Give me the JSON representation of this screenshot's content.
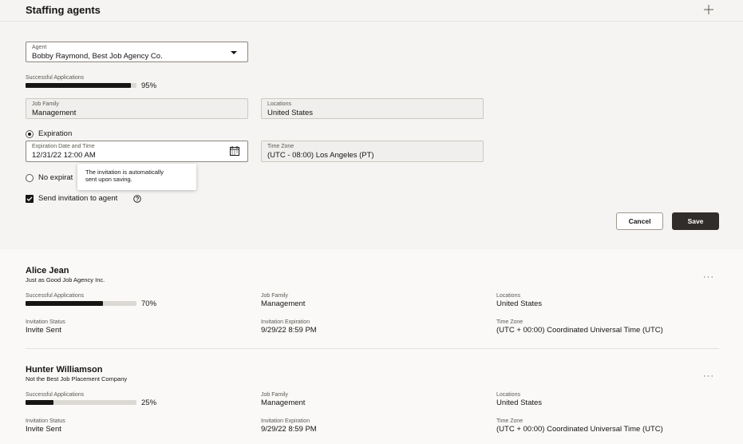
{
  "header": {
    "title": "Staffing agents",
    "add_icon": "plus-icon"
  },
  "form": {
    "agent": {
      "label": "Agent",
      "value": "Bobby Raymond, Best Job Agency Co."
    },
    "successful_applications": {
      "label": "Successful Applications",
      "percent": 95,
      "percent_text": "95%"
    },
    "job_family": {
      "label": "Job Family",
      "value": "Management"
    },
    "locations": {
      "label": "Locations",
      "value": "United States"
    },
    "expiration_option": {
      "label": "Expiration",
      "selected": true
    },
    "expiration_date": {
      "label": "Expiration Date and Time",
      "value": "12/31/22 12:00 AM",
      "icon": "calendar-icon"
    },
    "time_zone": {
      "label": "Time Zone",
      "value": "(UTC - 08:00) Los Angeles (PT)"
    },
    "no_expiration_option": {
      "label": "No expirat",
      "selected": false
    },
    "tooltip": {
      "line1": "The invitation is automatically",
      "line2": "sent upon saving."
    },
    "send_invitation": {
      "label": "Send invitation to agent",
      "checked": true,
      "icon": "help-icon"
    },
    "cancel_label": "Cancel",
    "save_label": "Save"
  },
  "agents": [
    {
      "name": "Alice Jean",
      "agency": "Just as Good Job Agency Inc.",
      "successful_label": "Successful Applications",
      "percent": 70,
      "percent_text": "70%",
      "job_family_label": "Job Family",
      "job_family": "Management",
      "locations_label": "Locations",
      "locations": "United States",
      "status_label": "Invitation Status",
      "status": "Invite Sent",
      "expiration_label": "Invitation Expiration",
      "expiration": "9/29/22 8:59 PM",
      "tz_label": "Time Zone",
      "tz": "(UTC + 00:00) Coordinated Universal Time (UTC)",
      "more": "···"
    },
    {
      "name": "Hunter Williamson",
      "agency": "Not the Best Job Placement Company",
      "successful_label": "Successful Applications",
      "percent": 25,
      "percent_text": "25%",
      "job_family_label": "Job Family",
      "job_family": "Management",
      "locations_label": "Locations",
      "locations": "United States",
      "status_label": "Invitation Status",
      "status": "Invite Sent",
      "expiration_label": "Invitation Expiration",
      "expiration": "9/29/22 8:59 PM",
      "tz_label": "Time Zone",
      "tz": "(UTC + 00:00) Coordinated Universal Time (UTC)",
      "more": "···"
    }
  ]
}
